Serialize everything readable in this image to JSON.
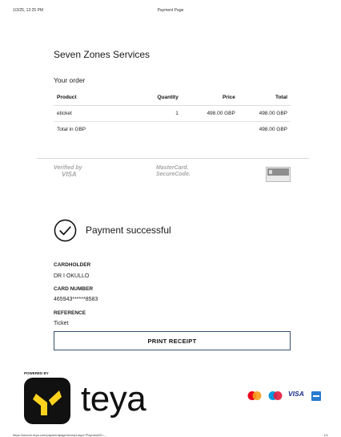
{
  "print_header": {
    "date": "1/3/25, 12:25 PM",
    "title": "Payment Page"
  },
  "merchant_name": "Seven Zones Services",
  "order": {
    "heading": "Your order",
    "columns": [
      "Product",
      "Quantity",
      "Price",
      "Total"
    ],
    "rows": [
      {
        "product": "eticket",
        "quantity": "1",
        "price": "498.00 GBP",
        "total": "498.00 GBP"
      }
    ],
    "total_label": "Total in GBP",
    "total_value": "498.00 GBP"
  },
  "security_badges": {
    "visa_line1": "Verified by",
    "visa_line2": "VISA",
    "mastercard_line1": "MasterCard.",
    "mastercard_line2": "SecureCode."
  },
  "status": {
    "message": "Payment successful",
    "icon": "check-circle-icon"
  },
  "receipt": {
    "cardholder_label": "CARDHOLDER",
    "cardholder_value": "DR I OKULLO",
    "card_number_label": "CARD NUMBER",
    "card_number_value": "465943******8583",
    "reference_label": "REFERENCE",
    "reference_value": "Ticket"
  },
  "print_button": "PRINT RECEIPT",
  "footer_brand": {
    "powered_by": "POWERED BY",
    "brand": "teya",
    "brand_color": "#FFD21E"
  },
  "card_logos": {
    "visa_text": "VISA"
  },
  "print_footer": {
    "url": "https://secure.teya.com/paymentpage/receipt.aspx?PaymentID=...",
    "page": "1/1"
  }
}
